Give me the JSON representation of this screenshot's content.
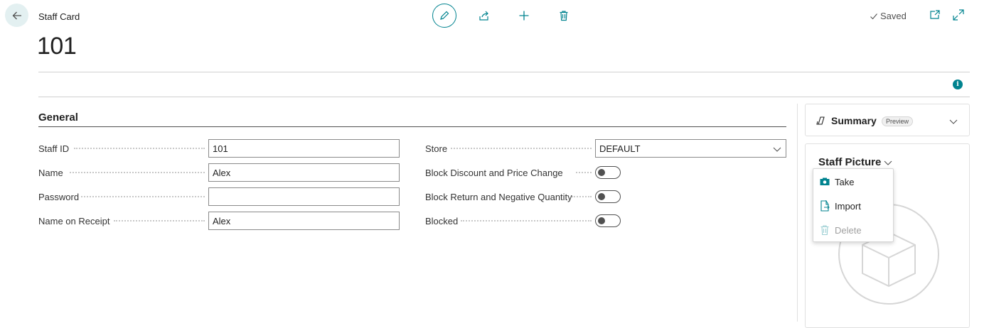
{
  "header": {
    "breadcrumb": "Staff Card",
    "title": "101",
    "status": "Saved"
  },
  "toolbar": {
    "icons": [
      "edit-icon",
      "share-icon",
      "new-icon",
      "delete-icon"
    ]
  },
  "general": {
    "title": "General",
    "left_fields": [
      {
        "label": "Staff ID",
        "value": "101"
      },
      {
        "label": "Name",
        "value": "Alex"
      },
      {
        "label": "Password",
        "value": ""
      },
      {
        "label": "Name on Receipt",
        "value": "Alex"
      }
    ],
    "right_fields": {
      "store": {
        "label": "Store",
        "value": "DEFAULT"
      },
      "block_discount": {
        "label": "Block Discount and Price Change",
        "on": false
      },
      "block_return": {
        "label": "Block Return and Negative Quantity",
        "on": false
      },
      "blocked": {
        "label": "Blocked",
        "on": false
      }
    }
  },
  "factbox": {
    "summary": {
      "label": "Summary",
      "badge": "Preview"
    },
    "picture": {
      "label": "Staff Picture"
    },
    "menu": [
      {
        "label": "Take",
        "enabled": true
      },
      {
        "label": "Import",
        "enabled": true
      },
      {
        "label": "Delete",
        "enabled": false
      }
    ]
  },
  "info_badge": "i",
  "colors": {
    "accent": "#00838f",
    "accent_light": "#e3f0f1"
  }
}
